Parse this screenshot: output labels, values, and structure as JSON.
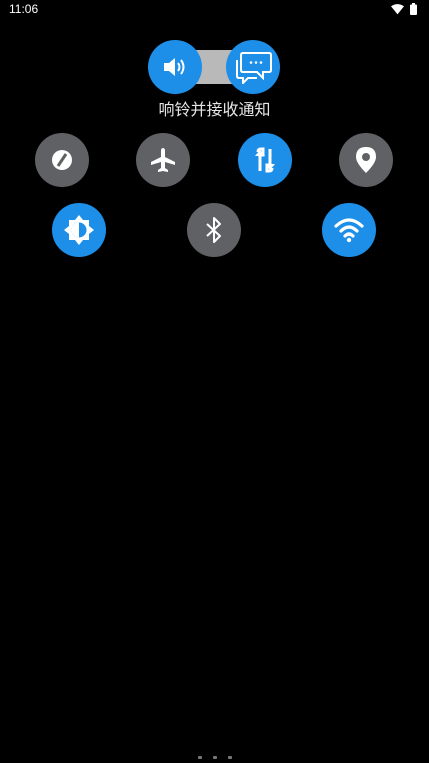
{
  "status_bar": {
    "time": "11:06",
    "icons": [
      "wifi-icon",
      "battery-icon"
    ]
  },
  "ringer": {
    "caption": "响铃并接收通知",
    "sound_icon": "volume-icon",
    "notify_icon": "message-bubbles-icon"
  },
  "tiles": [
    {
      "name": "rotation",
      "icon": "auto-rotate-icon",
      "state": "off"
    },
    {
      "name": "airplane",
      "icon": "airplane-icon",
      "state": "off"
    },
    {
      "name": "data-sync",
      "icon": "sync-arrows-icon",
      "state": "on"
    },
    {
      "name": "location",
      "icon": "location-pin-icon",
      "state": "off"
    },
    {
      "name": "brightness",
      "icon": "brightness-icon",
      "state": "on"
    },
    {
      "name": "bluetooth",
      "icon": "bluetooth-icon",
      "state": "off"
    },
    {
      "name": "wifi",
      "icon": "wifi-icon",
      "state": "on"
    }
  ],
  "colors": {
    "active": "#1d8fe8",
    "inactive": "#5f6164",
    "background": "#000000"
  }
}
